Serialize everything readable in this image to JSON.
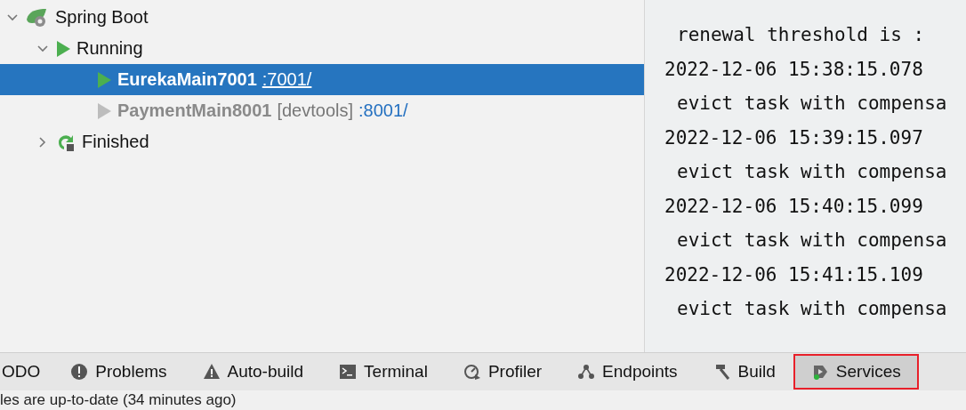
{
  "services_tree": [
    {
      "label": "Spring Boot",
      "kind": "spring",
      "expanded": true,
      "selected": false,
      "children": [
        {
          "label": "Running",
          "kind": "running",
          "expanded": true,
          "selected": false,
          "children": [
            {
              "label": "EurekaMain7001",
              "kind": "app",
              "active": true,
              "selected": true,
              "port": ":7001/"
            },
            {
              "label": "PaymentMain8001",
              "kind": "app",
              "active": false,
              "selected": false,
              "tag": "[devtools]",
              "port": ":8001/"
            }
          ]
        },
        {
          "label": "Finished",
          "kind": "finished",
          "expanded": false,
          "selected": false
        }
      ]
    }
  ],
  "log_lines": [
    {
      "kind": "message",
      "text": "renewal threshold is :"
    },
    {
      "kind": "timestamp",
      "text": "2022-12-06 15:38:15.078"
    },
    {
      "kind": "message",
      "text": "evict task with compensa"
    },
    {
      "kind": "timestamp",
      "text": "2022-12-06 15:39:15.097"
    },
    {
      "kind": "message",
      "text": "evict task with compensa"
    },
    {
      "kind": "timestamp",
      "text": "2022-12-06 15:40:15.099"
    },
    {
      "kind": "message",
      "text": "evict task with compensa"
    },
    {
      "kind": "timestamp",
      "text": "2022-12-06 15:41:15.109"
    },
    {
      "kind": "message",
      "text": "evict task with compensa"
    }
  ],
  "tool_tabs": [
    {
      "label": "ODO",
      "kind": "none",
      "selected": false,
      "highlighted": false
    },
    {
      "label": "Problems",
      "kind": "problems",
      "selected": false,
      "highlighted": false
    },
    {
      "label": "Auto-build",
      "kind": "warning",
      "selected": false,
      "highlighted": false
    },
    {
      "label": "Terminal",
      "kind": "terminal",
      "selected": false,
      "highlighted": false
    },
    {
      "label": "Profiler",
      "kind": "profiler",
      "selected": false,
      "highlighted": false
    },
    {
      "label": "Endpoints",
      "kind": "endpoints",
      "selected": false,
      "highlighted": false
    },
    {
      "label": "Build",
      "kind": "build",
      "selected": false,
      "highlighted": false
    },
    {
      "label": "Services",
      "kind": "services",
      "selected": true,
      "highlighted": true
    }
  ],
  "status_bar": {
    "text": "les are up-to-date (34 minutes ago)"
  }
}
